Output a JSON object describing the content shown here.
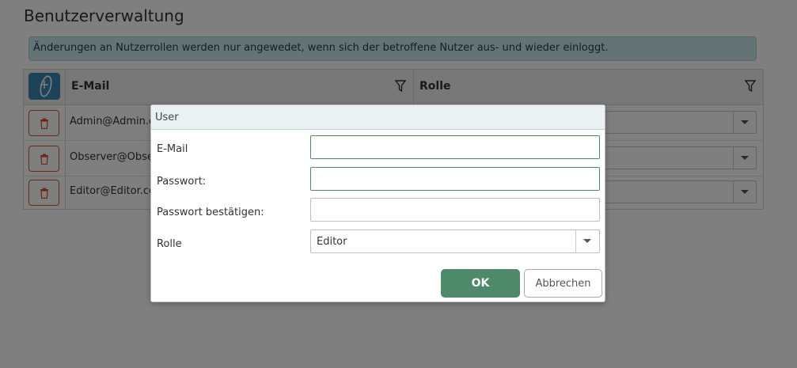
{
  "page": {
    "title": "Benutzerverwaltung",
    "info": "Änderungen an Nutzerrollen werden nur angewedet, wenn sich der betroffene Nutzer aus- und wieder einloggt."
  },
  "grid": {
    "columns": {
      "email": "E-Mail",
      "rolle": "Rolle"
    },
    "rows": [
      {
        "email": "Admin@Admin.c"
      },
      {
        "email": "Observer@Obse"
      },
      {
        "email": "Editor@Editor.co"
      }
    ]
  },
  "dialog": {
    "title": "User",
    "fields": {
      "email_label": "E-Mail",
      "email_value": "",
      "password_label": "Passwort:",
      "password_value": "",
      "confirm_label": "Passwort bestätigen:",
      "confirm_value": "",
      "role_label": "Rolle",
      "role_value": "Editor"
    },
    "ok_label": "OK",
    "cancel_label": "Abbrechen"
  },
  "colors": {
    "primary_green": "#4e8a6a",
    "info_bg": "#c7e6ec",
    "add_button": "#3a86b0",
    "delete_border": "#d6532f"
  },
  "icons": {
    "add": "add-user-icon",
    "filter": "filter-icon",
    "delete": "trash-icon",
    "dropdown": "chevron-down-icon"
  }
}
